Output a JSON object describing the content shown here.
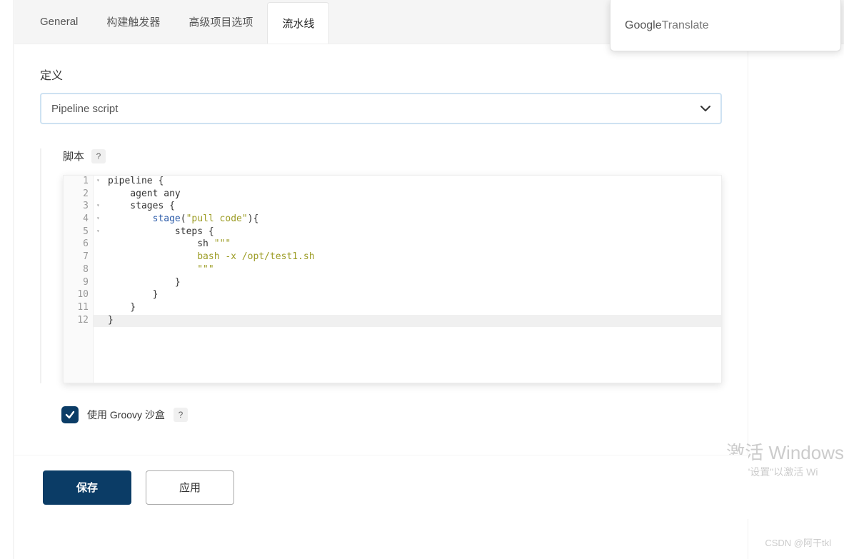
{
  "tabs": {
    "general": "General",
    "triggers": "构建触发器",
    "advanced": "高级项目选项",
    "pipeline": "流水线"
  },
  "translate": {
    "google": "Google",
    "label": " Translate"
  },
  "definition": {
    "label": "定义",
    "value": "Pipeline script"
  },
  "script": {
    "label": "脚本",
    "lines": [
      {
        "n": "1",
        "fold": true,
        "code": [
          [
            "",
            "pipeline {"
          ]
        ]
      },
      {
        "n": "2",
        "fold": false,
        "code": [
          [
            "",
            "    agent any"
          ]
        ]
      },
      {
        "n": "3",
        "fold": true,
        "code": [
          [
            "",
            "    stages {"
          ]
        ]
      },
      {
        "n": "4",
        "fold": true,
        "code": [
          [
            "",
            "        "
          ],
          [
            "fn",
            "stage"
          ],
          [
            "",
            "("
          ],
          [
            "str",
            "\"pull code\""
          ],
          [
            "",
            "){"
          ]
        ]
      },
      {
        "n": "5",
        "fold": true,
        "code": [
          [
            "",
            "            steps {"
          ]
        ]
      },
      {
        "n": "6",
        "fold": false,
        "code": [
          [
            "",
            "                sh "
          ],
          [
            "str",
            "\"\"\""
          ]
        ]
      },
      {
        "n": "7",
        "fold": false,
        "code": [
          [
            "str",
            "                bash -x /opt/test1.sh"
          ]
        ]
      },
      {
        "n": "8",
        "fold": false,
        "code": [
          [
            "str",
            "                \"\"\""
          ]
        ]
      },
      {
        "n": "9",
        "fold": false,
        "code": [
          [
            "",
            "            }"
          ]
        ]
      },
      {
        "n": "10",
        "fold": false,
        "code": [
          [
            "",
            "        }"
          ]
        ]
      },
      {
        "n": "11",
        "fold": false,
        "code": [
          [
            "",
            "    }"
          ]
        ]
      },
      {
        "n": "12",
        "fold": false,
        "hl": true,
        "code": [
          [
            "",
            "}"
          ]
        ]
      }
    ]
  },
  "sandbox": {
    "label": "使用 Groovy 沙盒",
    "checked": true
  },
  "buttons": {
    "save": "保存",
    "apply": "应用"
  },
  "watermark": {
    "line1": "激活 Windows",
    "line2": "转到\"设置\"以激活 Wi"
  },
  "credit": "CSDN @阿干tkl"
}
